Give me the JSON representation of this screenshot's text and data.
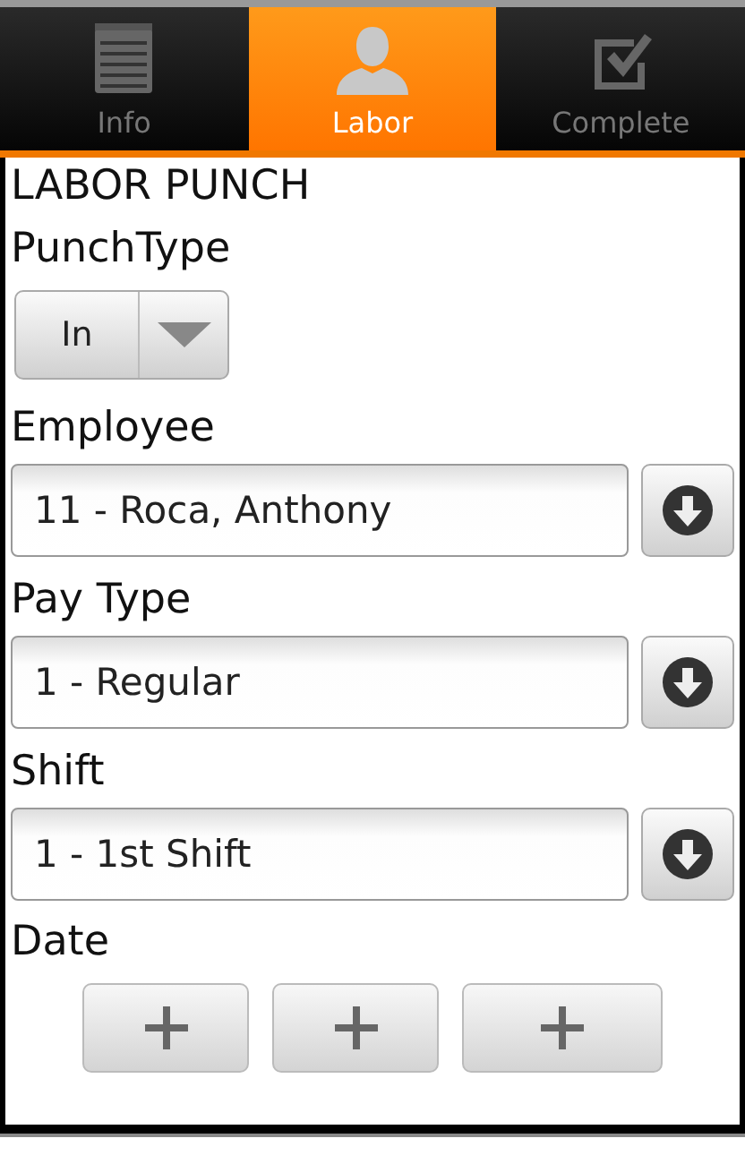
{
  "tabs": [
    {
      "label": "Info",
      "kind": "notepad",
      "selected": false
    },
    {
      "label": "Labor",
      "kind": "person",
      "selected": true
    },
    {
      "label": "Complete",
      "kind": "checkbox",
      "selected": false
    }
  ],
  "title": "LABOR PUNCH",
  "punch_type": {
    "label": "PunchType",
    "value": "In"
  },
  "fields": [
    {
      "label": "Employee",
      "value": "11 - Roca, Anthony"
    },
    {
      "label": "Pay Type",
      "value": "1 - Regular"
    },
    {
      "label": "Shift",
      "value": "1 - 1st Shift"
    }
  ],
  "date": {
    "label": "Date",
    "buttons": [
      {
        "kind": "increment"
      },
      {
        "kind": "increment"
      },
      {
        "kind": "increment"
      }
    ]
  }
}
